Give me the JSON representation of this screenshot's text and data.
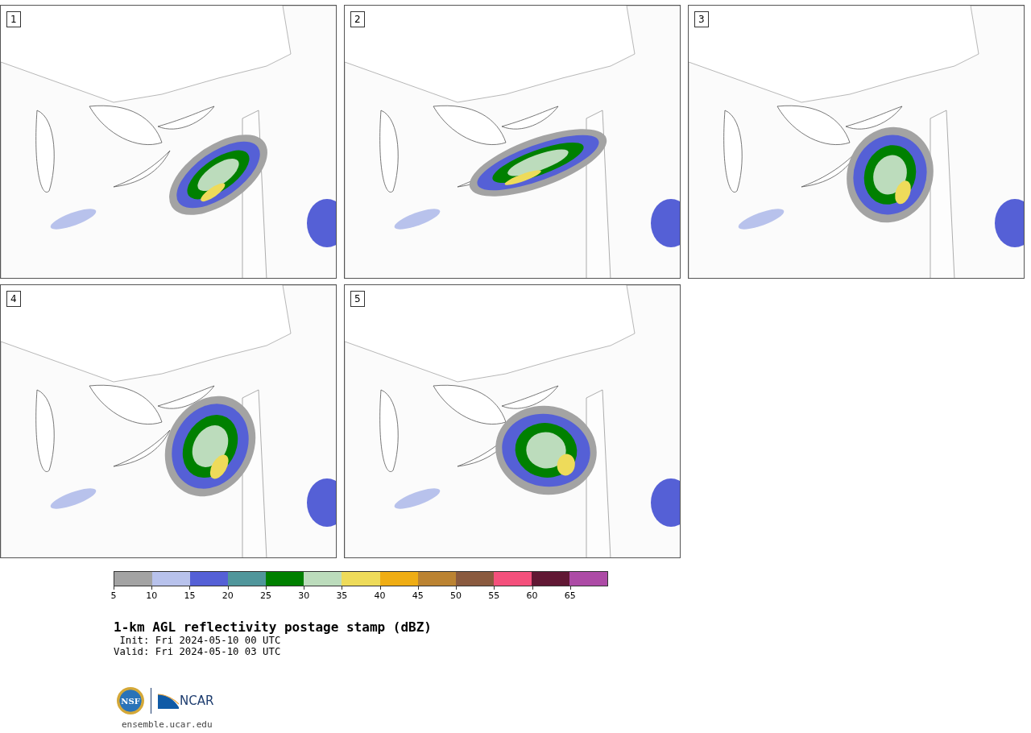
{
  "panels": [
    {
      "label": "1"
    },
    {
      "label": "2"
    },
    {
      "label": "3"
    },
    {
      "label": "4"
    },
    {
      "label": "5"
    }
  ],
  "colorbar": {
    "segments": [
      {
        "color": "#a3a3a3"
      },
      {
        "color": "#b8c2ec"
      },
      {
        "color": "#5560d6"
      },
      {
        "color": "#50969b"
      },
      {
        "color": "#008000"
      },
      {
        "color": "#bcdcbc"
      },
      {
        "color": "#eedb5a"
      },
      {
        "color": "#efad14"
      },
      {
        "color": "#bb8332"
      },
      {
        "color": "#8a5a3f"
      },
      {
        "color": "#f4507c"
      },
      {
        "color": "#611834"
      },
      {
        "color": "#ad4ba6"
      }
    ],
    "ticks": [
      "5",
      "10",
      "15",
      "20",
      "25",
      "30",
      "35",
      "40",
      "45",
      "50",
      "55",
      "60",
      "65"
    ]
  },
  "title": "1-km AGL reflectivity postage stamp (dBZ)",
  "init": " Init: Fri 2024-05-10 00 UTC",
  "valid": "Valid: Fri 2024-05-10 03 UTC",
  "logo": {
    "left": "NSF",
    "right": "NCAR"
  },
  "footer": "ensemble.ucar.edu"
}
